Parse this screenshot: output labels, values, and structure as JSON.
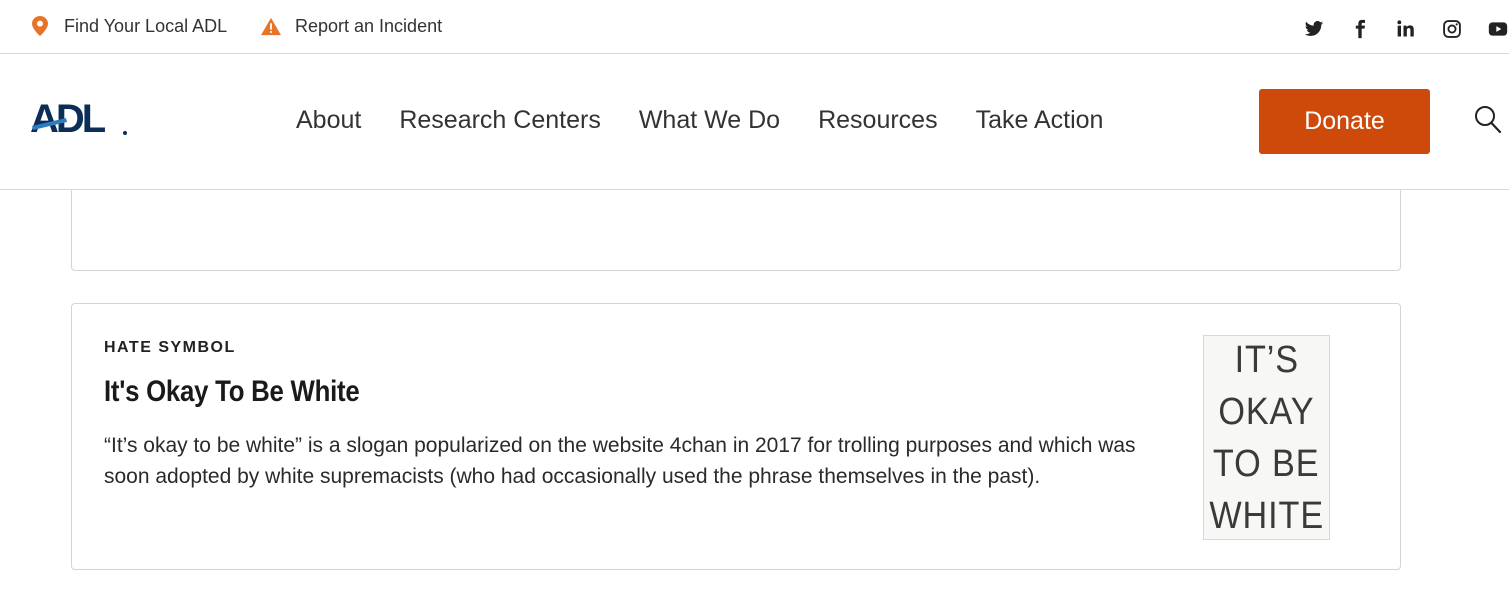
{
  "utility": {
    "find_local": "Find Your Local ADL",
    "report": "Report an Incident",
    "social": [
      "twitter-icon",
      "facebook-icon",
      "linkedin-icon",
      "instagram-icon",
      "youtube-icon"
    ]
  },
  "nav": {
    "logo_text": "ADL",
    "items": [
      "About",
      "Research Centers",
      "What We Do",
      "Resources",
      "Take Action"
    ],
    "donate": "Donate"
  },
  "card": {
    "eyebrow": "HATE SYMBOL",
    "title": "It's Okay To Be White",
    "description": "“It’s okay to be white” is a slogan popularized on the website 4chan in 2017 for trolling purposes and which was soon adopted by white supremacists (who had occasionally used the phrase themselves in the past).",
    "image_lines": [
      "IT’S",
      "OKAY",
      "TO BE",
      "WHITE"
    ]
  },
  "colors": {
    "accent": "#cd4a0a",
    "icon_orange": "#e8742a",
    "logo_navy": "#0b2d56",
    "logo_blue": "#2f7dc1"
  }
}
